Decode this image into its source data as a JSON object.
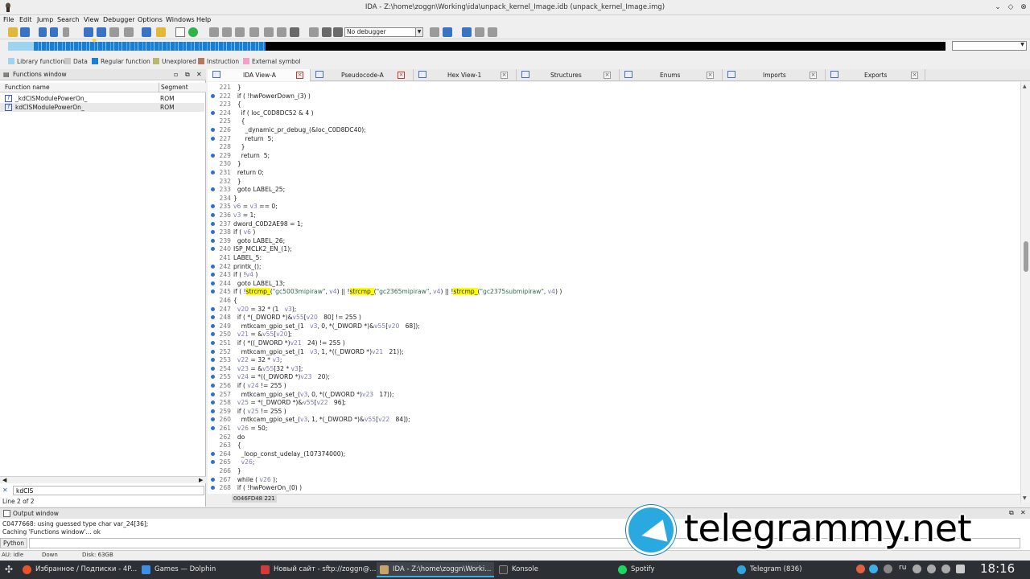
{
  "window": {
    "title": "IDA - Z:\\home\\zoggn\\Working\\ida\\unpack_kernel_Image.idb (unpack_kernel_Image.img)"
  },
  "menu": [
    "File",
    "Edit",
    "Jump",
    "Search",
    "View",
    "Debugger",
    "Options",
    "Windows",
    "Help"
  ],
  "toolbar": {
    "debugger_select": "No debugger"
  },
  "legend": [
    {
      "label": "Library function",
      "color": "#9fd4f0"
    },
    {
      "label": "Data",
      "color": "#c8c8c8"
    },
    {
      "label": "Regular function",
      "color": "#1a7fd0"
    },
    {
      "label": "Unexplored",
      "color": "#b8b870"
    },
    {
      "label": "Instruction",
      "color": "#b07a60"
    },
    {
      "label": "External symbol",
      "color": "#f2a0c8"
    }
  ],
  "functions_window": {
    "title": "Functions window",
    "col_name": "Function name",
    "col_segment": "Segment",
    "rows": [
      {
        "name": "_kdCISModulePowerOn_",
        "segment": "ROM"
      },
      {
        "name": "kdCISModulePowerOn_",
        "segment": "ROM"
      }
    ],
    "filter": "kdCIS",
    "status": "Line 2 of 2"
  },
  "tabs": [
    {
      "label": "IDA View-A"
    },
    {
      "label": "Pseudocode-A"
    },
    {
      "label": "Hex View-1"
    },
    {
      "label": "Structures"
    },
    {
      "label": "Enums"
    },
    {
      "label": "Imports"
    },
    {
      "label": "Exports"
    }
  ],
  "code": {
    "status_address": "0046FD48 221",
    "lines": [
      {
        "n": "221",
        "dot": false,
        "html": "  }"
      },
      {
        "n": "222",
        "dot": true,
        "html": "  if ( !hwPowerDown_(3) )"
      },
      {
        "n": "223",
        "dot": false,
        "html": "  {"
      },
      {
        "n": "224",
        "dot": true,
        "html": "    if ( loc_C0D8DC52 &amp; 4 )"
      },
      {
        "n": "225",
        "dot": false,
        "html": "    {"
      },
      {
        "n": "226",
        "dot": true,
        "html": "      _dynamic_pr_debug_(&amp;loc_C0D8DC40);"
      },
      {
        "n": "227",
        "dot": true,
        "html": "      return  5;"
      },
      {
        "n": "228",
        "dot": false,
        "html": "    }"
      },
      {
        "n": "229",
        "dot": true,
        "html": "    return  5;"
      },
      {
        "n": "230",
        "dot": false,
        "html": "  }"
      },
      {
        "n": "231",
        "dot": true,
        "html": "  return 0;"
      },
      {
        "n": "232",
        "dot": false,
        "html": "  }"
      },
      {
        "n": "233",
        "dot": true,
        "html": "  goto LABEL_25;"
      },
      {
        "n": "234",
        "dot": false,
        "html": "}"
      },
      {
        "n": "235",
        "dot": true,
        "html": "<span class='var'>v6</span> = <span class='var'>v3</span> == 0;"
      },
      {
        "n": "236",
        "dot": true,
        "html": "<span class='var'>v3</span> = 1;"
      },
      {
        "n": "237",
        "dot": true,
        "html": "dword_C0D2AE98 = 1;"
      },
      {
        "n": "238",
        "dot": true,
        "html": "if ( <span class='var'>v6</span> )"
      },
      {
        "n": "239",
        "dot": true,
        "html": "  goto LABEL_26;"
      },
      {
        "n": "240",
        "dot": true,
        "html": "ISP_MCLK2_EN_(1);"
      },
      {
        "n": "241",
        "dot": false,
        "html": "LABEL_5:"
      },
      {
        "n": "242",
        "dot": true,
        "html": "printk_();"
      },
      {
        "n": "243",
        "dot": true,
        "html": "if ( !<span class='var'>v4</span> )"
      },
      {
        "n": "244",
        "dot": true,
        "html": "  goto LABEL_13;"
      },
      {
        "n": "245",
        "dot": true,
        "html": "if ( !<span class='hl'>strcmp_</span>(<span class='str'>\"gc5003mipiraw\"</span>, <span class='var'>v4</span>) || !<span class='hl'>strcmp_</span>(<span class='str'>\"gc2365mipiraw\"</span>, <span class='var'>v4</span>) || !<span class='hl'>strcmp_</span>(<span class='str'>\"gc2375submipiraw\"</span>, <span class='var'>v4</span>) )"
      },
      {
        "n": "246",
        "dot": false,
        "html": "{"
      },
      {
        "n": "247",
        "dot": true,
        "html": "  <span class='var'>v20</span> = 32 * (1   <span class='var'>v3</span>);"
      },
      {
        "n": "248",
        "dot": true,
        "html": "  if ( *(_DWORD *)&amp;<span class='var'>v55</span>[<span class='var'>v20</span>   80] != 255 )"
      },
      {
        "n": "249",
        "dot": true,
        "html": "    mtkcam_gpio_set_(1   <span class='var'>v3</span>, 0, *(_DWORD *)&amp;<span class='var'>v55</span>[<span class='var'>v20</span>   68]);"
      },
      {
        "n": "250",
        "dot": true,
        "html": "  <span class='var'>v21</span> = &amp;<span class='var'>v55</span>[<span class='var'>v20</span>];"
      },
      {
        "n": "251",
        "dot": true,
        "html": "  if ( *((_DWORD *)<span class='var'>v21</span>   24) != 255 )"
      },
      {
        "n": "252",
        "dot": true,
        "html": "    mtkcam_gpio_set_(1   <span class='var'>v3</span>, 1, *((_DWORD *)<span class='var'>v21</span>   21));"
      },
      {
        "n": "253",
        "dot": true,
        "html": "  <span class='var'>v22</span> = 32 * <span class='var'>v3</span>;"
      },
      {
        "n": "254",
        "dot": true,
        "html": "  <span class='var'>v23</span> = &amp;<span class='var'>v55</span>[32 * <span class='var'>v3</span>];"
      },
      {
        "n": "255",
        "dot": true,
        "html": "  <span class='var'>v24</span> = *((_DWORD *)<span class='var'>v23</span>   20);"
      },
      {
        "n": "256",
        "dot": true,
        "html": "  if ( <span class='var'>v24</span> != 255 )"
      },
      {
        "n": "257",
        "dot": true,
        "html": "    mtkcam_gpio_set_(<span class='var'>v3</span>, 0, *((_DWORD *)<span class='var'>v23</span>   17));"
      },
      {
        "n": "258",
        "dot": true,
        "html": "  <span class='var'>v25</span> = *(_DWORD *)&amp;<span class='var'>v55</span>[<span class='var'>v22</span>   96];"
      },
      {
        "n": "259",
        "dot": true,
        "html": "  if ( <span class='var'>v25</span> != 255 )"
      },
      {
        "n": "260",
        "dot": true,
        "html": "    mtkcam_gpio_set_(<span class='var'>v3</span>, 1, *(_DWORD *)&amp;<span class='var'>v55</span>[<span class='var'>v22</span>   84]);"
      },
      {
        "n": "261",
        "dot": true,
        "html": "  <span class='var'>v26</span> = 50;"
      },
      {
        "n": "262",
        "dot": false,
        "html": "  do"
      },
      {
        "n": "263",
        "dot": false,
        "html": "  {"
      },
      {
        "n": "264",
        "dot": true,
        "html": "    _loop_const_udelay_(107374000);"
      },
      {
        "n": "265",
        "dot": true,
        "html": "    <span class='var'>v26</span>;"
      },
      {
        "n": "266",
        "dot": false,
        "html": "  }"
      },
      {
        "n": "267",
        "dot": true,
        "html": "  while ( <span class='var'>v26</span> );"
      },
      {
        "n": "268",
        "dot": true,
        "html": "  if ( !hwPowerOn_(0) )"
      }
    ]
  },
  "output_window": {
    "title": "Output window",
    "line1": "C0477668: using guessed type char var_24[36];",
    "line2": "Caching 'Functions window'... ok",
    "python_label": "Python"
  },
  "ida_status": {
    "au": "AU:  idle",
    "direction": "Down",
    "disk": "Disk: 63GB"
  },
  "watermark": "telegrammy.net",
  "taskbar": {
    "items": [
      {
        "label": "Избранное / Подписки - 4P...",
        "color": "#e8542a"
      },
      {
        "label": "Games — Dolphin",
        "color": "#3d8ee6"
      },
      {
        "label": "Новый сайт - sftp://zoggn@...",
        "color": "#d33a3a"
      },
      {
        "label": "IDA - Z:\\home\\zoggn\\Worki...",
        "color": "#c9a46a"
      },
      {
        "label": "Konsole",
        "color": "#3a3a3a"
      },
      {
        "label": "Spotify",
        "color": "#1ed760"
      },
      {
        "label": "Telegram (836)",
        "color": "#2ca5e0"
      }
    ],
    "lang": "ru",
    "clock": "18:16"
  }
}
